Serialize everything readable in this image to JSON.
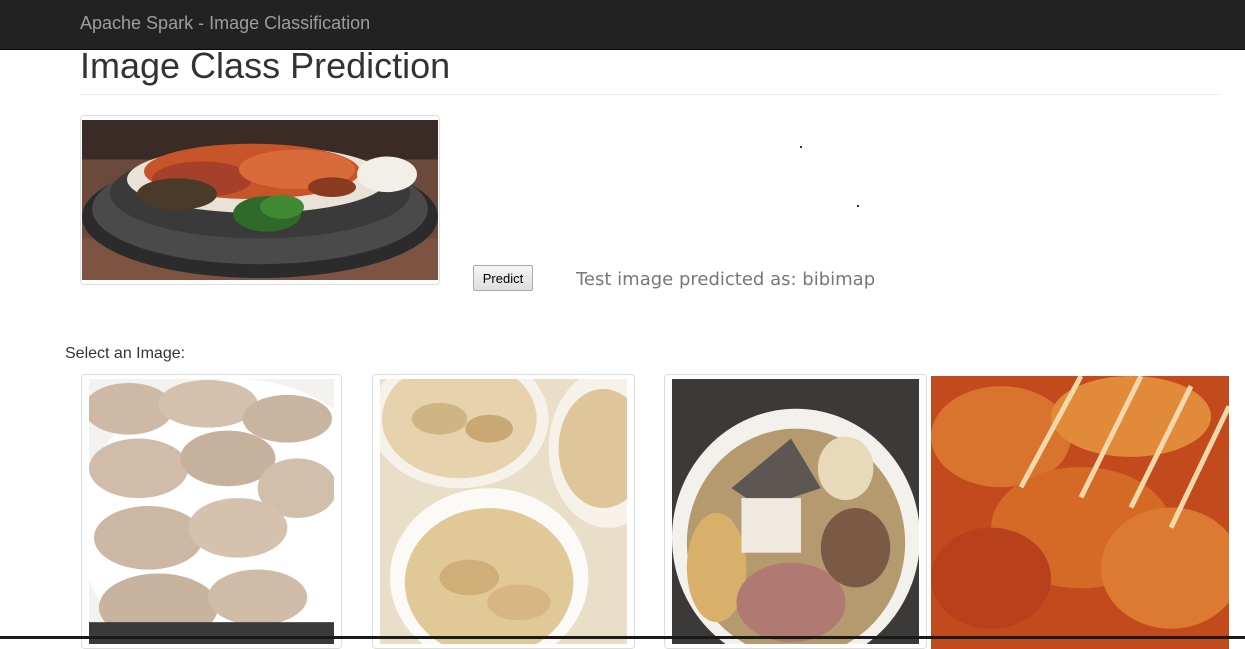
{
  "navbar": {
    "brand": "Apache Spark - Image Classification"
  },
  "page": {
    "title": "Image Class Prediction"
  },
  "predict": {
    "button_label": "Predict",
    "result_prefix": "Test image predicted as:",
    "result_class": "bibimap"
  },
  "gallery": {
    "label": "Select an Image:",
    "items": [
      {
        "icon": "dumplings-photo"
      },
      {
        "icon": "fried-dumplings-photo"
      },
      {
        "icon": "oden-photo"
      },
      {
        "icon": "fish-cake-skewers-photo"
      }
    ]
  },
  "colors": {
    "navbar_bg": "#222222",
    "brand_text": "#9d9d9d",
    "result_text": "#777777"
  }
}
